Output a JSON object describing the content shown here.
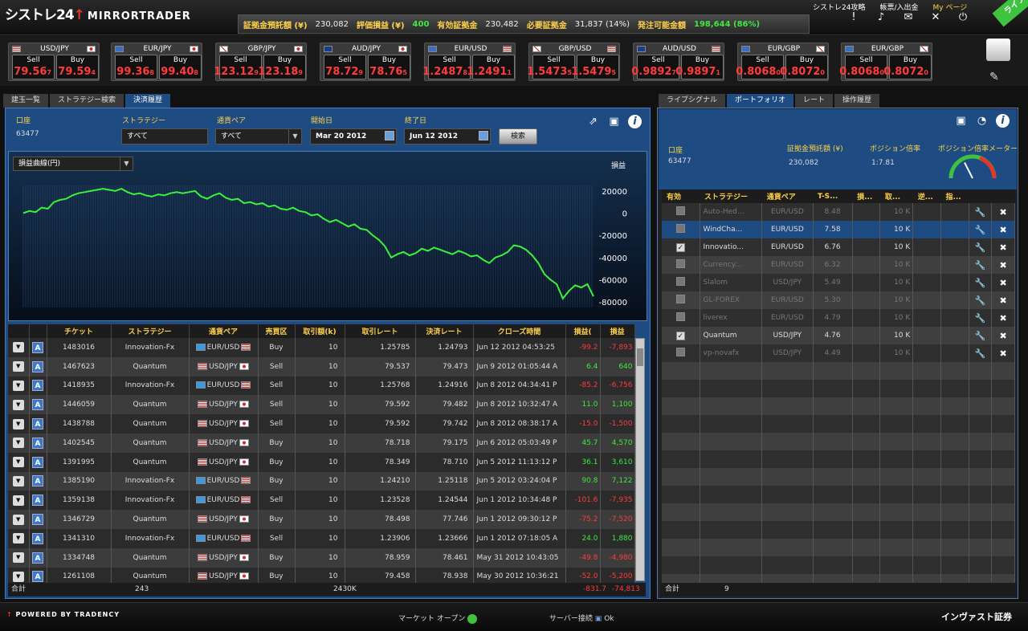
{
  "header": {
    "brand": "シストレ24",
    "brand_sub": "MIRRORTRADER",
    "summary": [
      {
        "label": "証拠金預託額 (¥)",
        "value": "230,082",
        "style": "val"
      },
      {
        "label": "評価損益 (¥)",
        "value": "400",
        "style": "grn"
      },
      {
        "label": "有効証拠金",
        "value": "230,482",
        "style": "val"
      },
      {
        "label": "必要証拠金",
        "value": "31,837 (14%)",
        "style": "val"
      },
      {
        "label": "発注可能金額",
        "value": "198,644 (86%)",
        "style": "grn"
      }
    ],
    "links": {
      "guide": "シストレ24攻略",
      "deposit": "帳票/入出金",
      "mypage": "My ページ"
    },
    "icons": [
      "alert-icon",
      "sound-icon",
      "chat-icon",
      "tools-icon",
      "power-icon"
    ],
    "live_badge": "ライブ"
  },
  "rates": [
    {
      "pair": "USD/JPY",
      "f1": "us",
      "f2": "jp",
      "sell_main": "79.56",
      "sell_sup": "7",
      "buy_main": "79.59",
      "buy_sup": "4"
    },
    {
      "pair": "EUR/JPY",
      "f1": "eu",
      "f2": "jp",
      "sell_main": "99.36",
      "sell_sup": "8",
      "buy_main": "99.40",
      "buy_sup": "8"
    },
    {
      "pair": "GBP/JPY",
      "f1": "gb",
      "f2": "jp",
      "sell_main": "123.12",
      "sell_sup": "9",
      "buy_main": "123.18",
      "buy_sup": "9"
    },
    {
      "pair": "AUD/JPY",
      "f1": "au",
      "f2": "jp",
      "sell_main": "78.72",
      "sell_sup": "9",
      "buy_main": "78.76",
      "buy_sup": "5"
    },
    {
      "pair": "EUR/USD",
      "f1": "eu",
      "f2": "us",
      "sell_main": "1.2487",
      "sell_sup": "8",
      "buy_main": "1.2491",
      "buy_sup": "1"
    },
    {
      "pair": "GBP/USD",
      "f1": "gb",
      "f2": "us",
      "sell_main": "1.5473",
      "sell_sup": "5",
      "buy_main": "1.5479",
      "buy_sup": "5"
    },
    {
      "pair": "AUD/USD",
      "f1": "au",
      "f2": "us",
      "sell_main": "0.9892",
      "sell_sup": "7",
      "buy_main": "0.9897",
      "buy_sup": "1"
    },
    {
      "pair": "EUR/GBP",
      "f1": "eu",
      "f2": "gb",
      "sell_main": "0.8068",
      "sell_sup": "0",
      "buy_main": "0.8072",
      "buy_sup": "0"
    },
    {
      "pair": "EUR/GBP",
      "f1": "eu",
      "f2": "gb",
      "sell_main": "0.8068",
      "sell_sup": "0",
      "buy_main": "0.8072",
      "buy_sup": "0"
    }
  ],
  "rate_labels": {
    "sell": "Sell",
    "buy": "Buy"
  },
  "left": {
    "tabs": [
      "建玉一覧",
      "ストラテジー検索",
      "決済履歴"
    ],
    "filters": {
      "account_label": "口座",
      "account_value": "63477",
      "strategy_label": "ストラテジー",
      "strategy_value": "すべて",
      "pair_label": "通貨ペア",
      "pair_value": "すべて",
      "start_label": "開始日",
      "start_value": "Mar 20 2012",
      "end_label": "終了日",
      "end_value": "Jun 12 2012",
      "search_button": "検索"
    },
    "chart_selector": "損益曲線(円)",
    "chart_legend": "損益",
    "columns": [
      "",
      "",
      "チケット",
      "ストラテジー",
      "通貨ペア",
      "売買区",
      "取引額(k)",
      "取引レート",
      "決済レート",
      "クローズ時間",
      "損益(",
      "損益"
    ],
    "rows": [
      {
        "ticket": "1483016",
        "strategy": "Innovation-Fx",
        "pair": "EUR/USD",
        "f1": "eu",
        "f2": "us",
        "side": "Buy",
        "amount": "10",
        "open": "1.25785",
        "close": "1.24793",
        "time": "Jun 12 2012 04:53:25",
        "pips": "-99.2",
        "pl": "-7,893"
      },
      {
        "ticket": "1467623",
        "strategy": "Quantum",
        "pair": "USD/JPY",
        "f1": "us",
        "f2": "jp",
        "side": "Sell",
        "amount": "10",
        "open": "79.537",
        "close": "79.473",
        "time": "Jun 9 2012 01:05:44 A",
        "pips": "6.4",
        "pl": "640"
      },
      {
        "ticket": "1418935",
        "strategy": "Innovation-Fx",
        "pair": "EUR/USD",
        "f1": "eu",
        "f2": "us",
        "side": "Sell",
        "amount": "10",
        "open": "1.25768",
        "close": "1.24916",
        "time": "Jun 8 2012 04:34:41 P",
        "pips": "-85.2",
        "pl": "-6,756"
      },
      {
        "ticket": "1446059",
        "strategy": "Quantum",
        "pair": "USD/JPY",
        "f1": "us",
        "f2": "jp",
        "side": "Sell",
        "amount": "10",
        "open": "79.592",
        "close": "79.482",
        "time": "Jun 8 2012 10:32:47 A",
        "pips": "11.0",
        "pl": "1,100"
      },
      {
        "ticket": "1438788",
        "strategy": "Quantum",
        "pair": "USD/JPY",
        "f1": "us",
        "f2": "jp",
        "side": "Sell",
        "amount": "10",
        "open": "79.592",
        "close": "79.742",
        "time": "Jun 8 2012 08:38:17 A",
        "pips": "-15.0",
        "pl": "-1,500"
      },
      {
        "ticket": "1402545",
        "strategy": "Quantum",
        "pair": "USD/JPY",
        "f1": "us",
        "f2": "jp",
        "side": "Buy",
        "amount": "10",
        "open": "78.718",
        "close": "79.175",
        "time": "Jun 6 2012 05:03:49 P",
        "pips": "45.7",
        "pl": "4,570"
      },
      {
        "ticket": "1391995",
        "strategy": "Quantum",
        "pair": "USD/JPY",
        "f1": "us",
        "f2": "jp",
        "side": "Buy",
        "amount": "10",
        "open": "78.349",
        "close": "78.710",
        "time": "Jun 5 2012 11:13:12 P",
        "pips": "36.1",
        "pl": "3,610"
      },
      {
        "ticket": "1385190",
        "strategy": "Innovation-Fx",
        "pair": "EUR/USD",
        "f1": "eu",
        "f2": "us",
        "side": "Buy",
        "amount": "10",
        "open": "1.24210",
        "close": "1.25118",
        "time": "Jun 5 2012 03:24:04 P",
        "pips": "90.8",
        "pl": "7,122"
      },
      {
        "ticket": "1359138",
        "strategy": "Innovation-Fx",
        "pair": "EUR/USD",
        "f1": "eu",
        "f2": "us",
        "side": "Sell",
        "amount": "10",
        "open": "1.23528",
        "close": "1.24544",
        "time": "Jun 1 2012 10:34:48 P",
        "pips": "-101.6",
        "pl": "-7,935"
      },
      {
        "ticket": "1346729",
        "strategy": "Quantum",
        "pair": "USD/JPY",
        "f1": "us",
        "f2": "jp",
        "side": "Buy",
        "amount": "10",
        "open": "78.498",
        "close": "77.746",
        "time": "Jun 1 2012 09:30:12 P",
        "pips": "-75.2",
        "pl": "-7,520"
      },
      {
        "ticket": "1341310",
        "strategy": "Innovation-Fx",
        "pair": "EUR/USD",
        "f1": "eu",
        "f2": "us",
        "side": "Sell",
        "amount": "10",
        "open": "1.23906",
        "close": "1.23666",
        "time": "Jun 1 2012 07:18:05 A",
        "pips": "24.0",
        "pl": "1,880"
      },
      {
        "ticket": "1334748",
        "strategy": "Quantum",
        "pair": "USD/JPY",
        "f1": "us",
        "f2": "jp",
        "side": "Buy",
        "amount": "10",
        "open": "78.959",
        "close": "78.461",
        "time": "May 31 2012 10:43:05",
        "pips": "-49.8",
        "pl": "-4,980"
      },
      {
        "ticket": "1261108",
        "strategy": "Quantum",
        "pair": "USD/JPY",
        "f1": "us",
        "f2": "jp",
        "side": "Buy",
        "amount": "10",
        "open": "79.458",
        "close": "78.938",
        "time": "May 30 2012 10:36:21",
        "pips": "-52.0",
        "pl": "-5,200"
      }
    ],
    "footer": {
      "label": "合計",
      "count": "243",
      "volume": "2430K",
      "pips": "-831.7",
      "pl": "-74,813"
    }
  },
  "chart_data": {
    "type": "line",
    "ylim": [
      -85000,
      25000
    ],
    "yticks": [
      "20000",
      "0",
      "-20000",
      "-40000",
      "-60000",
      "-80000"
    ],
    "series": [
      {
        "values": [
          0,
          2000,
          1000,
          5000,
          4000,
          10000,
          12000,
          13000,
          16000,
          18000,
          19000,
          20000,
          21000,
          22000,
          21000,
          20000,
          22000,
          19000,
          17000,
          18000,
          16000,
          15000,
          17000,
          16000,
          18000,
          19000,
          18000,
          19000,
          20000,
          15000,
          13000,
          16000,
          18000,
          14000,
          12000,
          13000,
          9000,
          10000,
          8000,
          9000,
          6000,
          7000,
          4000,
          3000,
          5000,
          2000,
          1000,
          -2000,
          -1000,
          -5000,
          -8000,
          -6000,
          -9000,
          -12000,
          -10000,
          -14000,
          -15000,
          -20000,
          -24000,
          -30000,
          -40000,
          -37000,
          -35000,
          -38000,
          -36000,
          -32000,
          -34000,
          -31000,
          -33000,
          -35000,
          -37000,
          -34000,
          -36000,
          -39000,
          -38000,
          -42000,
          -45000,
          -40000,
          -38000,
          -35000,
          -29000,
          -30000,
          -33000,
          -38000,
          -45000,
          -55000,
          -60000,
          -64000,
          -77000,
          -70000,
          -65000,
          -67000,
          -64000,
          -75000
        ]
      }
    ]
  },
  "right": {
    "tabs": [
      "ライブシグナル",
      "ポートフォリオ",
      "レート",
      "操作履歴"
    ],
    "account_label": "口座",
    "account_value": "63477",
    "deposit_label": "証拠金預託額 (¥)",
    "deposit_value": "230,082",
    "leverage_label": "ポジション倍率",
    "leverage_value": "1:7.81",
    "meter_label": "ポジション倍率メーター",
    "meter_level": 0.35,
    "columns": [
      "有効",
      "ストラテジー",
      "通貨ペア",
      "T-S...",
      "損...",
      "取...",
      "逆...",
      "指...",
      "",
      ""
    ],
    "rows": [
      {
        "checked": false,
        "off": true,
        "name": "Auto-Hed...",
        "pair": "EUR/USD",
        "ts": "8.48",
        "amount": "10 K"
      },
      {
        "checked": false,
        "off": true,
        "sel": true,
        "name": "WindCha...",
        "pair": "EUR/USD",
        "ts": "7.58",
        "amount": "10 K"
      },
      {
        "checked": true,
        "off": false,
        "name": "Innovatio...",
        "pair": "EUR/USD",
        "ts": "6.76",
        "amount": "10 K"
      },
      {
        "checked": false,
        "off": true,
        "name": "Currency...",
        "pair": "EUR/USD",
        "ts": "6.32",
        "amount": "10 K"
      },
      {
        "checked": false,
        "off": true,
        "name": "Slalom",
        "pair": "USD/JPY",
        "ts": "5.49",
        "amount": "10 K"
      },
      {
        "checked": false,
        "off": true,
        "name": "GL-FOREX",
        "pair": "EUR/USD",
        "ts": "5.30",
        "amount": "10 K"
      },
      {
        "checked": false,
        "off": true,
        "name": "liverex",
        "pair": "EUR/USD",
        "ts": "4.79",
        "amount": "10 K"
      },
      {
        "checked": true,
        "off": false,
        "name": "Quantum",
        "pair": "USD/JPY",
        "ts": "4.76",
        "amount": "10 K"
      },
      {
        "checked": false,
        "off": true,
        "name": "vp-novafx",
        "pair": "USD/JPY",
        "ts": "4.49",
        "amount": "10 K"
      }
    ],
    "footer": {
      "label": "合計",
      "count": "9"
    }
  },
  "bottom": {
    "powered": "Powered By Tradency",
    "market_label": "マーケット オープン",
    "server_label": "サーバー接続",
    "server_value": "Ok",
    "company": "インヴァスト証券"
  }
}
